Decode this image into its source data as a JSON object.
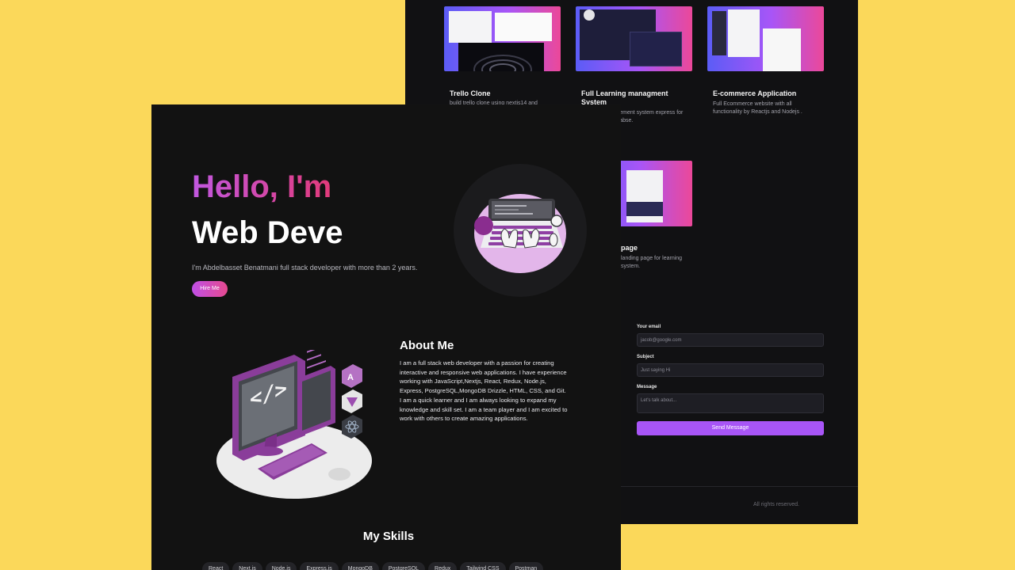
{
  "colors": {
    "background": "#fbd85a",
    "surface": "#111113",
    "accent_purple": "#a855f7",
    "accent_pink": "#e23a7a"
  },
  "projects": [
    {
      "title": "Trello Clone",
      "description": "build trello clone using nextjs14 and"
    },
    {
      "title": "Full Learning managment System",
      "description": "learning management system express for backend for databse."
    },
    {
      "title": "E-commerce Application",
      "description": "Full Ecommerce website with all functionality by Reactjs and Nodejs ."
    },
    {
      "title": "page",
      "description": "landing page for learning system."
    }
  ],
  "contact": {
    "email_label": "Your email",
    "email_placeholder": "jacob@google.com",
    "subject_label": "Subject",
    "subject_placeholder": "Just saying Hi",
    "message_label": "Message",
    "message_placeholder": "Let's talk about...",
    "send_label": "Send Message"
  },
  "footer": {
    "text": "All rights reserved."
  },
  "hero": {
    "greeting": "Hello, I'm",
    "role": "Web Deve",
    "intro": "I'm Abdelbasset Benatmani full stack developer with more than 2 years.",
    "hire_label": "Hire Me"
  },
  "about": {
    "title": "About Me",
    "text": "I am a full stack web developer with a passion for creating interactive and responsive web applications. I have experience working with JavaScript,Nextjs, React, Redux, Node.js, Express, PostgreSQL,MongoDB Drizzle, HTML, CSS, and Git. I am a quick learner and I am always looking to expand my knowledge and skill set. I am a team player and I am excited to work with others to create amazing applications."
  },
  "skills": {
    "title": "My Skills",
    "chips": [
      "React",
      "Next.js",
      "Node.js",
      "Express.js",
      "MongoDB",
      "PostgreSQL",
      "Redux",
      "Tailwind CSS",
      "Postman"
    ]
  },
  "icons": [
    "code-icon",
    "angular-icon",
    "vue-icon",
    "react-icon",
    "keyboard-icon",
    "monitor-icon"
  ]
}
